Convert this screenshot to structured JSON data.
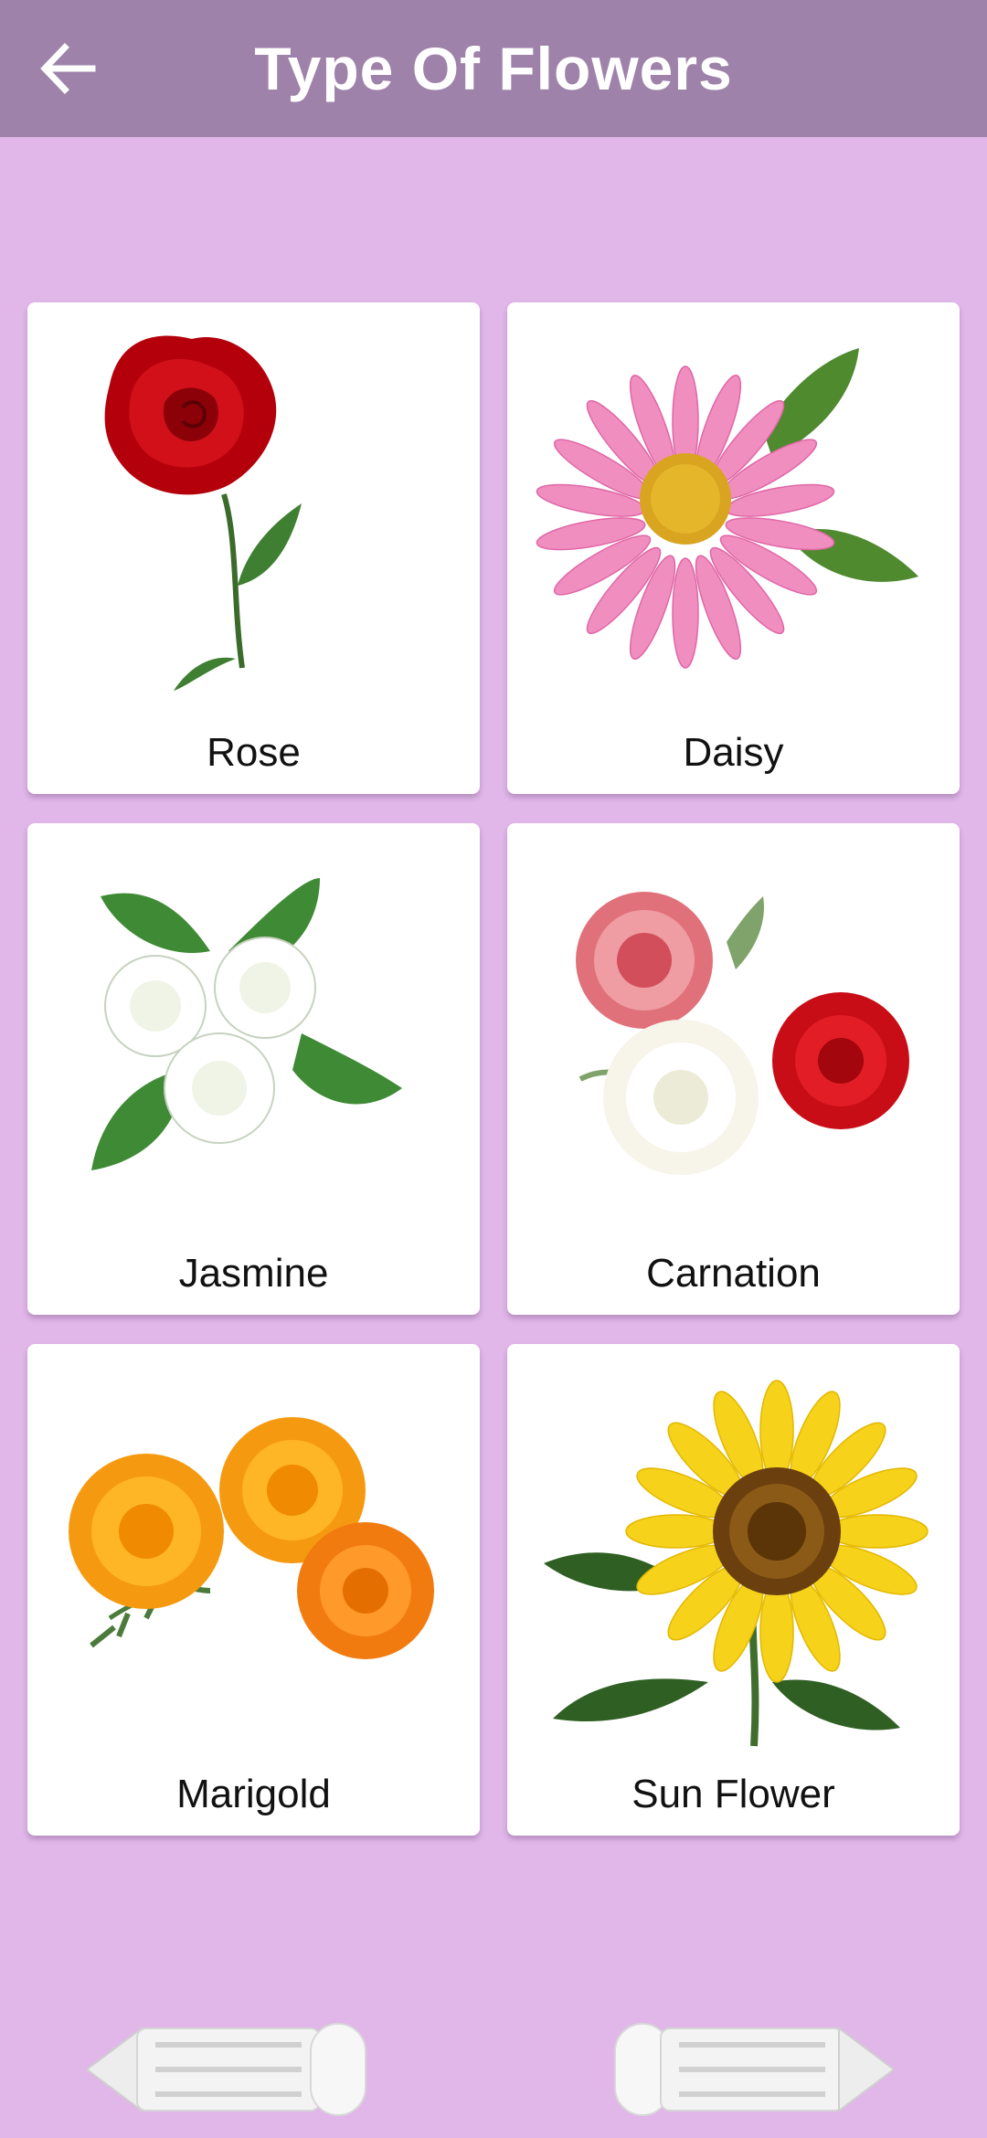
{
  "app": {
    "title": "Type Of Flowers"
  },
  "colors": {
    "appbar": "#9e82aa",
    "background": "#e0b7e8",
    "card": "#ffffff"
  },
  "flowers": [
    {
      "name": "Rose",
      "icon": "rose-image"
    },
    {
      "name": "Daisy",
      "icon": "daisy-image"
    },
    {
      "name": "Jasmine",
      "icon": "jasmine-image"
    },
    {
      "name": "Carnation",
      "icon": "carnation-image"
    },
    {
      "name": "Marigold",
      "icon": "marigold-image"
    },
    {
      "name": "Sun Flower",
      "icon": "sunflower-image"
    }
  ],
  "navigation": {
    "back_icon": "arrow-left-icon",
    "prev_icon": "previous-pencil-icon",
    "next_icon": "next-pencil-icon"
  }
}
